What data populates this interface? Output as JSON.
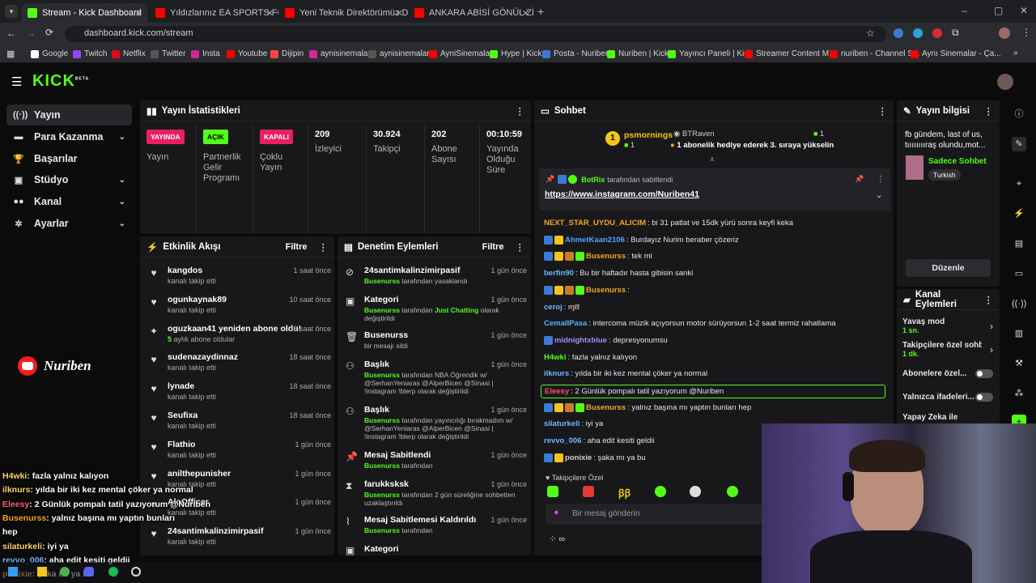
{
  "browser": {
    "tabs": [
      {
        "title": "Stream - Kick Dashboard",
        "color": "#53fc18"
      },
      {
        "title": "Yıldızlarınız EA SPORTS FC26 R",
        "color": "#ff0000"
      },
      {
        "title": "Yeni Teknik Direktörümüz Dom",
        "color": "#ff0000"
      },
      {
        "title": "ANKARA ABİSİ GÖNÜL ZİYARET",
        "color": "#ff0000"
      }
    ],
    "url": "dashboard.kick.com/stream",
    "bookmarks": [
      "Google",
      "Twitch",
      "Netflix",
      "Twitter",
      "Insta",
      "Youtube",
      "Dijipin",
      "aynisinemalar",
      "aynisinemalar",
      "AyniSinemalar",
      "Hype | Kick",
      "Posta - Nuriben",
      "Nuriben | Kick",
      "Yayıncı Paneli | Kick",
      "Streamer Content M...",
      "nuriben - Channel S...",
      "Aynı Sinemalar - Ça..."
    ]
  },
  "kick": {
    "logo": "KICK",
    "logo_sup": "BETA",
    "brand_color": "#53fc18"
  },
  "sidebar": {
    "items": [
      {
        "label": "Yayın",
        "icon": "broadcast-icon",
        "chevron": false
      },
      {
        "label": "Para Kazanma",
        "icon": "money-icon",
        "chevron": true
      },
      {
        "label": "Başarılar",
        "icon": "trophy-icon",
        "chevron": false
      },
      {
        "label": "Stüdyo",
        "icon": "studio-icon",
        "chevron": true
      },
      {
        "label": "Kanal",
        "icon": "people-icon",
        "chevron": true
      },
      {
        "label": "Ayarlar",
        "icon": "gear-icon",
        "chevron": true
      }
    ]
  },
  "stats": {
    "title": "Yayın İstatistikleri",
    "cells": [
      {
        "badge": "YAYINDA",
        "badge_color": "#e91e63",
        "label": "Yayın"
      },
      {
        "badge": "AÇIK",
        "badge_color": "#53fc18",
        "label": "Partnerlik Gelir Programı"
      },
      {
        "badge": "KAPALI",
        "badge_color": "#e91e63",
        "label": "Çoklu Yayın"
      },
      {
        "value": "209",
        "label": "İzleyici"
      },
      {
        "value": "30.924",
        "label": "Takipçi"
      },
      {
        "value": "202",
        "label": "Abone Sayısı"
      },
      {
        "value": "00:10:59",
        "label": "Yayında Olduğu Süre"
      }
    ]
  },
  "activity": {
    "title": "Etkinlik Akışı",
    "filter": "Filtre",
    "items": [
      {
        "name": "kangdos",
        "sub": "kanalı takip etti",
        "time": "1 saat önce",
        "icon": "heart-icon"
      },
      {
        "name": "ogunkaynak89",
        "sub": "kanalı takip etti",
        "time": "10 saat önce",
        "icon": "heart-icon"
      },
      {
        "name": "oguzkaan41 yeniden abone oldu!",
        "sub": "5 aylık abone oldular",
        "time": "16 saat önce",
        "icon": "sparkle-icon"
      },
      {
        "name": "sudenazaydinnaz",
        "sub": "kanalı takip etti",
        "time": "18 saat önce",
        "icon": "heart-icon"
      },
      {
        "name": "lynade",
        "sub": "kanalı takip etti",
        "time": "18 saat önce",
        "icon": "heart-icon"
      },
      {
        "name": "Seufixa",
        "sub": "kanalı takip etti",
        "time": "18 saat önce",
        "icon": "heart-icon"
      },
      {
        "name": "Flathio",
        "sub": "kanalı takip etti",
        "time": "1 gün önce",
        "icon": "heart-icon"
      },
      {
        "name": "anilthepunisher",
        "sub": "kanalı takip etti",
        "time": "1 gün önce",
        "icon": "heart-icon"
      },
      {
        "name": "AloOfficer",
        "sub": "kanalı takip etti",
        "time": "1 gün önce",
        "icon": "heart-icon"
      },
      {
        "name": "24santimkalinzimirpasif",
        "sub": "kanalı takip etti",
        "time": "1 gün önce",
        "icon": "heart-icon"
      }
    ]
  },
  "moderation": {
    "title": "Denetim Eylemleri",
    "filter": "Filtre",
    "items": [
      {
        "name": "24santimkalinzimirpasif",
        "desc": "Busenurss tarafından yasaklandı",
        "time": "1 gün önce",
        "icon": "ban-icon"
      },
      {
        "name": "Kategori",
        "desc": "Busenurss tarafından Just Chatting olarak değiştirildi",
        "time": "1 gün önce",
        "icon": "category-icon"
      },
      {
        "name": "Busenurss",
        "desc": "bir mesajı sildi",
        "time": "1 gün önce",
        "icon": "trash-icon"
      },
      {
        "name": "Başlık",
        "desc": "Busenurss tarafından NBA Öğrendik w/ @SerhanYeniaras @AlperBicen @Sinasi | !instagram !blerp olarak değiştirildi",
        "time": "1 gün önce",
        "icon": "users-icon"
      },
      {
        "name": "Başlık",
        "desc": "Busenurss tarafından yayıncılığı bırakmadım w/ @SerhanYeniaras @AlperBicen @Sinasi | !instagram !blerp olarak değiştirildi",
        "time": "1 gün önce",
        "icon": "users-icon"
      },
      {
        "name": "Mesaj Sabitlendi",
        "desc": "Busenurss tarafından",
        "time": "1 gün önce",
        "icon": "pin-icon"
      },
      {
        "name": "farukksksk",
        "desc": "Busenurss tarafından 2 gün süreliğine sohbetten uzaklaştırıldı",
        "time": "1 gün önce",
        "icon": "hourglass-icon"
      },
      {
        "name": "Mesaj Sabitlemesi Kaldırıldı",
        "desc": "Busenurss tarafından",
        "time": "1 gün önce",
        "icon": "unpin-icon"
      },
      {
        "name": "Kategori",
        "desc": "",
        "time": "",
        "icon": "category-icon"
      }
    ]
  },
  "chat": {
    "title": "Sohbet",
    "top_gifter": {
      "name": "psmornings",
      "count": "1",
      "rank": "1"
    },
    "gift_user": {
      "name": "BTRaven",
      "count": "1",
      "text": "1 abonelik hediye ederek 3. sıraya yükselin"
    },
    "pinned": {
      "by": "BotRix",
      "by_suffix": "tarafından sabitlendi",
      "link": "https://www.instagram.com/Nuriben41"
    },
    "messages": [
      {
        "user": "NEXT_STAR_UYDU_ALICIM",
        "color": "#f5a623",
        "text": "bi 31 patlat ve 15dk yürü sonra keyfi keka",
        "badges": 0
      },
      {
        "user": "AhmetKaan2106",
        "color": "#4fa3ff",
        "text": "Burdayız Nurim beraber çözeriz",
        "badges": 2
      },
      {
        "user": "Busenurss",
        "color": "#f5a623",
        "text": "tek mi",
        "badges": 4
      },
      {
        "user": "berfin90",
        "color": "#6fb6ff",
        "text": "Bu bir haftadır hasta gibisin sanki",
        "badges": 0
      },
      {
        "user": "Busenurss",
        "color": "#f5a623",
        "text": "",
        "badges": 4
      },
      {
        "user": "ceroj",
        "color": "#6fb6ff",
        "text": "ɱℓℓ",
        "badges": 0
      },
      {
        "user": "CemalIPasa",
        "color": "#5ab0ff",
        "text": "intercoma müzik açıyorsun motor sürüyorsun 1-2 saat termiz rahatlama",
        "badges": 0
      },
      {
        "user": "midnightxblue",
        "color": "#a88bff",
        "text": "depresyonumsu",
        "badges": 1
      },
      {
        "user": "H4wki",
        "color": "#53fc18",
        "text": "fazla yalnız kalıyon",
        "badges": 0
      },
      {
        "user": "ilknurs",
        "color": "#6fb6ff",
        "text": "yılda bir iki kez mental çöker ya normal",
        "badges": 0
      },
      {
        "user": "Eleesy",
        "color": "#ff4d6d",
        "text": "2 Günlük pompalı tatil yazıyorum @Nuriben",
        "badges": 0,
        "highlight": true
      },
      {
        "user": "Busenurss",
        "color": "#f5a623",
        "text": "yalnız başına mı yaptın bunları hep",
        "badges": 4
      },
      {
        "user": "silaturkeli",
        "color": "#6fb6ff",
        "text": "iyi ya",
        "badges": 0
      },
      {
        "user": "revvo_006",
        "color": "#6fb6ff",
        "text": "aha edit kesiti geldii",
        "badges": 0
      },
      {
        "user": "ponixie",
        "color": "#cfcfcf",
        "text": "şaka mı ya bu",
        "badges": 2
      }
    ],
    "followers_only": "Takipçilere Özel",
    "input_placeholder": "Bir mesaj gönderin"
  },
  "stream_info": {
    "title": "Yayın bilgisi",
    "description": "fb gündem, last of us, tııııııııraş olundu,mot...",
    "category": "Sadece Sohbet",
    "language": "Turkish",
    "edit_label": "Düzenle"
  },
  "channel_actions": {
    "title": "Kanal Eylemleri",
    "slow_mode": "Yavaş mod",
    "slow_value": "1 sn.",
    "followers_mode": "Takipçilere özel sohbet",
    "followers_value": "1 dk.",
    "subs_mode": "Abonelere özel...",
    "emotes_mode": "Yalnızca ifadeleri...",
    "ai_mode": "Yapay Zeka ile"
  },
  "overlay": {
    "brand": "Nuriben",
    "chat": [
      {
        "user": "H4wki",
        "color": "#ffd36b",
        "text": ": fazla yalnız kalıyon"
      },
      {
        "user": "ilknurs",
        "color": "#ffd36b",
        "text": ": yılda bir iki kez mental çöker ya normal"
      },
      {
        "user": "Eleesy",
        "color": "#ff5c7a",
        "text": ": 2 Günlük pompalı tatil yazıyorum @Nuriben"
      },
      {
        "user": "Busenurss",
        "color": "#f5a623",
        "text": ": yalnız başına mı yaptın bunları"
      },
      {
        "user": "",
        "color": "#ffffff",
        "text": "hep"
      },
      {
        "user": "silaturkeli",
        "color": "#ffd36b",
        "text": ": iyi ya"
      },
      {
        "user": "revvo_006",
        "color": "#6fb6ff",
        "text": ": aha edit kesiti geldii"
      },
      {
        "user": "ponixie",
        "color": "#ffd36b",
        "text": ": şaka mı ya bu"
      }
    ]
  }
}
